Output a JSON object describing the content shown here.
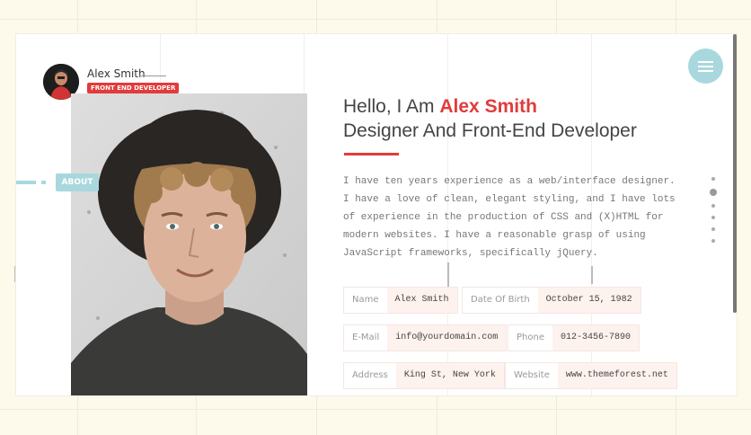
{
  "profile": {
    "name": "Alex Smith",
    "role": "FRONT END DEVELOPER"
  },
  "nav": {
    "about_tab": "ABOUT",
    "menu_icon": "hamburger-icon"
  },
  "hero": {
    "greeting_prefix": "Hello, I Am ",
    "greeting_name": "Alex Smith",
    "subtitle": "Designer And Front-End Developer"
  },
  "bio": "I have ten years experience as a web/interface designer. I have a love of clean, elegant styling, and I have lots of experience in the production of CSS and (X)HTML for modern websites. I have a reasonable grasp of using JavaScript frameworks, specifically jQuery.",
  "info": {
    "name_label": "Name",
    "name_value": "Alex Smith",
    "dob_label": "Date Of Birth",
    "dob_value": "October 15, 1982",
    "email_label": "E-Mail",
    "email_value": "info@yourdomain.com",
    "phone_label": "Phone",
    "phone_value": "012-3456-7890",
    "address_label": "Address",
    "address_value": "King St, New York",
    "website_label": "Website",
    "website_value": "www.themeforest.net"
  },
  "colors": {
    "accent": "#e23b3b",
    "teal": "#a8d8de",
    "background": "#fdfaeb"
  }
}
